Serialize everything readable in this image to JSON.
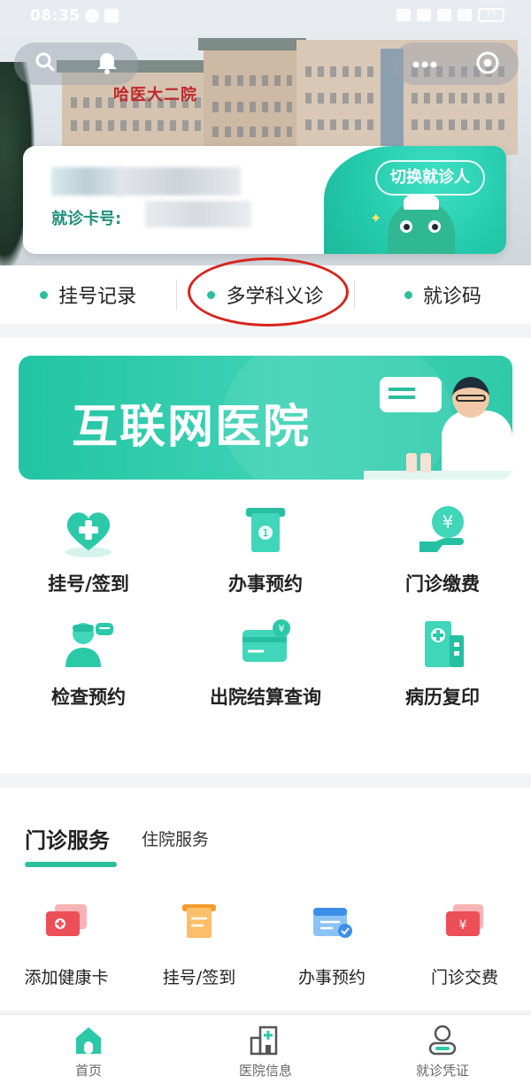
{
  "status_bar": {
    "time": "08:35",
    "battery": "75"
  },
  "hero": {
    "sign_text": "哈医大二院"
  },
  "patient_card": {
    "card_number_label": "就诊卡号:",
    "switch_button_label": "切换就诊人"
  },
  "quick_links": [
    {
      "label": "挂号记录"
    },
    {
      "label": "多学科义诊"
    },
    {
      "label": "就诊码"
    }
  ],
  "banner": {
    "title": "互联网医院"
  },
  "features": [
    {
      "label": "挂号/签到",
      "icon": "heart-plus-icon"
    },
    {
      "label": "办事预约",
      "icon": "ticket-icon"
    },
    {
      "label": "门诊缴费",
      "icon": "yen-hand-icon"
    },
    {
      "label": "检查预约",
      "icon": "doctor-chat-icon"
    },
    {
      "label": "出院结算查询",
      "icon": "yen-card-icon"
    },
    {
      "label": "病历复印",
      "icon": "hospital-building-icon"
    }
  ],
  "services": {
    "tabs": [
      {
        "label": "门诊服务",
        "active": true
      },
      {
        "label": "住院服务",
        "active": false
      }
    ],
    "items": [
      {
        "label": "添加健康卡",
        "icon": "health-card-icon"
      },
      {
        "label": "挂号/签到",
        "icon": "receipt-icon"
      },
      {
        "label": "办事预约",
        "icon": "calendar-check-icon"
      },
      {
        "label": "门诊交费",
        "icon": "yen-card-icon"
      }
    ]
  },
  "bottom_nav": [
    {
      "label": "首页",
      "icon": "home-icon",
      "active": true
    },
    {
      "label": "医院信息",
      "icon": "hospital-icon",
      "active": false
    },
    {
      "label": "就诊凭证",
      "icon": "user-card-icon",
      "active": false
    }
  ],
  "colors": {
    "accent": "#2bbf9d",
    "highlight_circle": "#d8241c",
    "card_label": "#1f8f7b"
  }
}
